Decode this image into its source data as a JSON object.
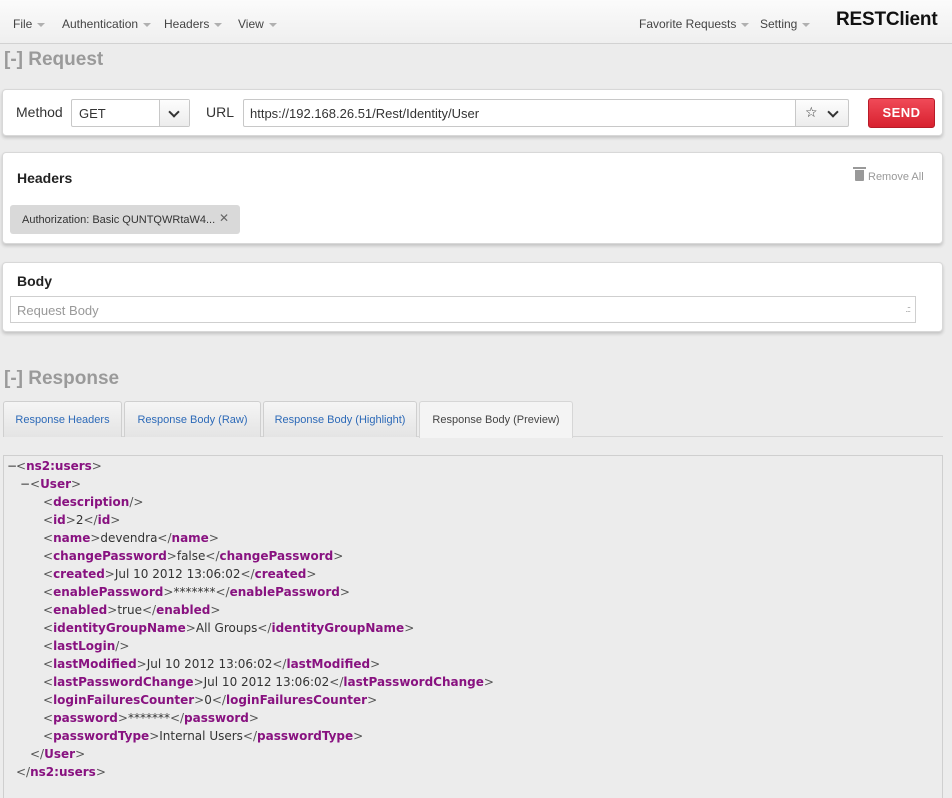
{
  "nav": {
    "left": [
      "File",
      "Authentication",
      "Headers",
      "View"
    ],
    "right": [
      "Favorite Requests",
      "Setting"
    ],
    "brand": "RESTClient"
  },
  "request": {
    "title_toggle": "[-]",
    "title": "Request",
    "method_label": "Method",
    "method_value": "GET",
    "url_label": "URL",
    "url_value": "https://192.168.26.51/Rest/Identity/User",
    "send_label": "SEND"
  },
  "headers": {
    "title": "Headers",
    "remove_all": "Remove All",
    "items": [
      {
        "text": "Authorization: Basic QUNTQWRtaW4..."
      }
    ]
  },
  "body": {
    "title": "Body",
    "placeholder": "Request Body"
  },
  "response": {
    "title_toggle": "[-]",
    "title": "Response",
    "tabs": [
      "Response Headers",
      "Response Body (Raw)",
      "Response Body (Highlight)",
      "Response Body (Preview)"
    ],
    "active_tab": 3,
    "xml": {
      "root": "ns2:users",
      "child": "User",
      "fields": [
        {
          "tag": "description",
          "value": null
        },
        {
          "tag": "id",
          "value": "2"
        },
        {
          "tag": "name",
          "value": "devendra"
        },
        {
          "tag": "changePassword",
          "value": "false"
        },
        {
          "tag": "created",
          "value": "Jul 10 2012 13:06:02"
        },
        {
          "tag": "enablePassword",
          "value": "*******"
        },
        {
          "tag": "enabled",
          "value": "true"
        },
        {
          "tag": "identityGroupName",
          "value": "All Groups"
        },
        {
          "tag": "lastLogin",
          "value": null
        },
        {
          "tag": "lastModified",
          "value": "Jul 10 2012 13:06:02"
        },
        {
          "tag": "lastPasswordChange",
          "value": "Jul 10 2012 13:06:02"
        },
        {
          "tag": "loginFailuresCounter",
          "value": "0"
        },
        {
          "tag": "password",
          "value": "*******"
        },
        {
          "tag": "passwordType",
          "value": "Internal Users"
        }
      ]
    }
  }
}
